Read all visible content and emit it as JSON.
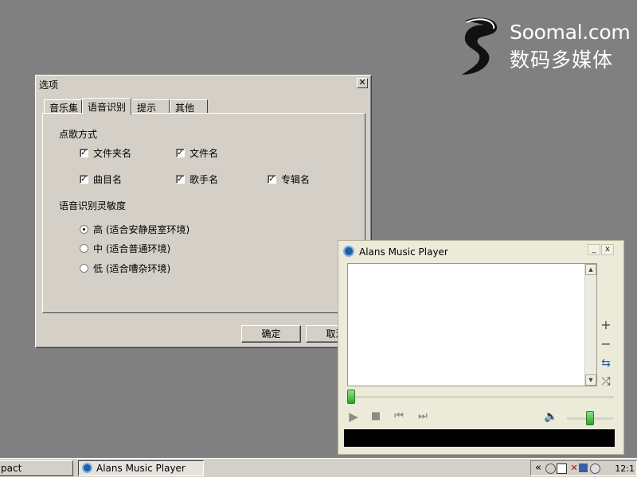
{
  "watermark": {
    "brand": "Soomal.com",
    "brand_cn": "数码多媒体"
  },
  "options_dialog": {
    "title": "选项",
    "close_symbol": "✕",
    "tabs": [
      {
        "label": "音乐集",
        "active": false
      },
      {
        "label": "语音识别",
        "active": true
      },
      {
        "label": "提示",
        "active": false
      },
      {
        "label": "其他",
        "active": false
      }
    ],
    "song_mode": {
      "label": "点歌方式",
      "options": [
        {
          "label": "文件夹名",
          "checked": true
        },
        {
          "label": "文件名",
          "checked": true
        },
        {
          "label": "曲目名",
          "checked": true
        },
        {
          "label": "歌手名",
          "checked": true
        },
        {
          "label": "专辑名",
          "checked": true
        }
      ]
    },
    "sensitivity": {
      "label": "语音识别灵敏度",
      "options": [
        {
          "label": "高 (适合安静居室环境)",
          "selected": true
        },
        {
          "label": "中 (适合普通环境)",
          "selected": false
        },
        {
          "label": "低 (适合嘈杂环境)",
          "selected": false
        }
      ]
    },
    "buttons": {
      "ok": "确定",
      "cancel": "取消"
    }
  },
  "player": {
    "title": "Alans Music Player",
    "minimize_symbol": "_",
    "close_symbol": "x",
    "side_controls": {
      "add": "+",
      "remove": "−",
      "repeat": "⇆",
      "shuffle": "⤮"
    },
    "seek_position": 0.0,
    "volume_level": 0.5,
    "controls": {
      "play": "▶",
      "stop": "■",
      "prev": "⏮",
      "next": "⏭",
      "volume": "🔈"
    }
  },
  "taskbar": {
    "items": [
      {
        "label": "pact",
        "pressed": false
      },
      {
        "label": "Alans Music Player",
        "pressed": true
      }
    ],
    "tray": {
      "expand": "«",
      "clock": "12:1"
    }
  }
}
